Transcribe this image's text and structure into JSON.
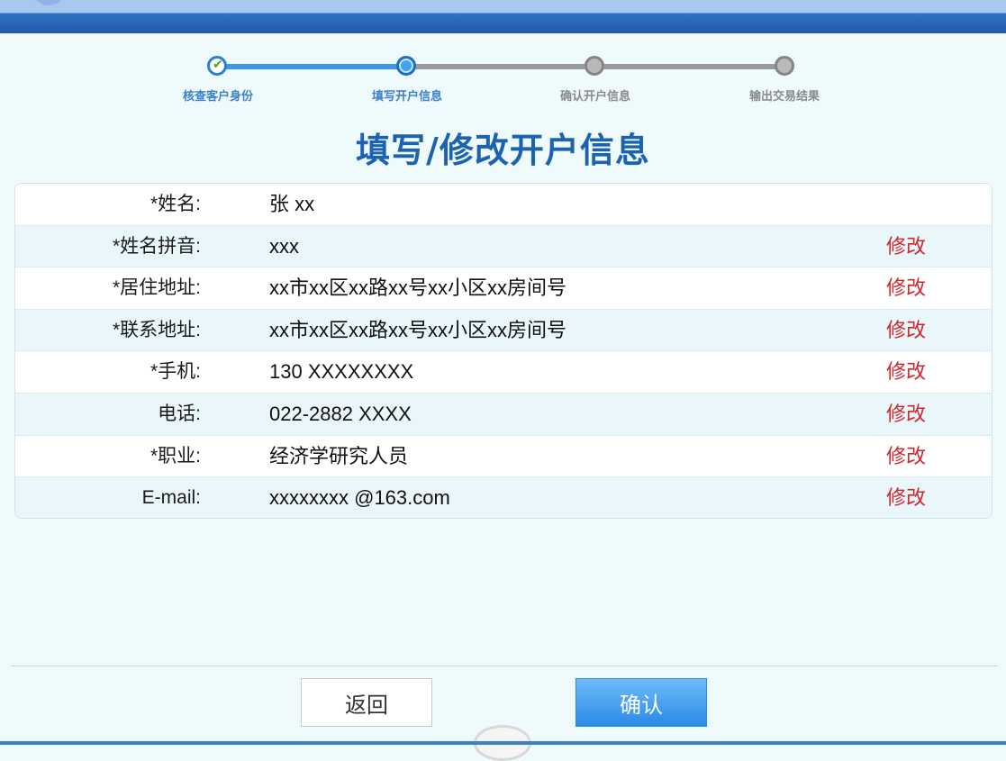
{
  "steps": [
    {
      "label": "核查客户身份",
      "state": "done"
    },
    {
      "label": "填写开户信息",
      "state": "active"
    },
    {
      "label": "确认开户信息",
      "state": "todo"
    },
    {
      "label": "输出交易结果",
      "state": "todo"
    }
  ],
  "page_title": "填写/修改开户信息",
  "form": {
    "edit_label": "修改",
    "rows": [
      {
        "label": "*姓名:",
        "value": "张  xx",
        "editable": false
      },
      {
        "label": "*姓名拼音:",
        "value": "xxx",
        "editable": true
      },
      {
        "label": "*居住地址:",
        "value": "xx市xx区xx路xx号xx小区xx房间号",
        "editable": true
      },
      {
        "label": "*联系地址:",
        "value": "xx市xx区xx路xx号xx小区xx房间号",
        "editable": true
      },
      {
        "label": "*手机:",
        "value": "130 XXXXXXXX",
        "editable": true
      },
      {
        "label": "电话:",
        "value": "022-2882 XXXX",
        "editable": true
      },
      {
        "label": "*职业:",
        "value": "经济学研究人员",
        "editable": true
      },
      {
        "label": "E-mail:",
        "value": "xxxxxxxx @163.com",
        "editable": true
      }
    ]
  },
  "buttons": {
    "back": "返回",
    "confirm": "确认"
  },
  "colors": {
    "accent": "#1b62b0",
    "edit": "#d0272d",
    "confirm_button": "#2a8ae6"
  }
}
